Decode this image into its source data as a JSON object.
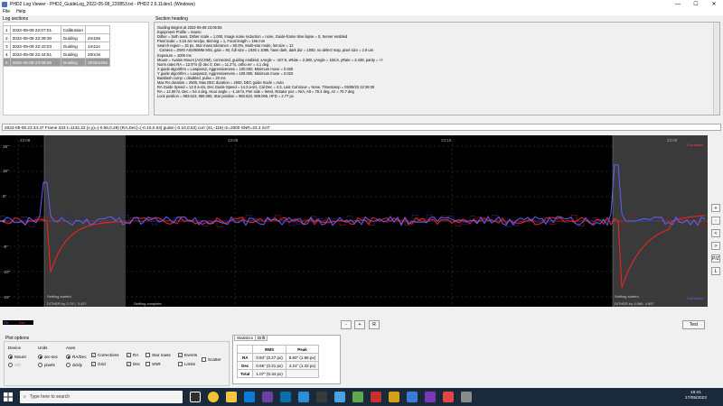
{
  "window": {
    "title": "PHD2 Log Viewer - PHD2_GuideLog_2022-05-08_220853.txt - PHD2 2.6.11dev1 (Windows)",
    "minimize": "—",
    "maximize": "☐",
    "close": "✕"
  },
  "menu": {
    "file": "File",
    "help": "Help"
  },
  "log_sections": {
    "label": "Log sections",
    "rows": [
      {
        "num": "1",
        "time": "2022-05-08 22:07:01",
        "type": "Calibration",
        "dur": ""
      },
      {
        "num": "2",
        "time": "2022-05-08 22:39:30",
        "type": "Guiding",
        "dur": "2m18s"
      },
      {
        "num": "3",
        "time": "2022-05-08 22:43:03",
        "type": "Guiding",
        "dur": "1m11s"
      },
      {
        "num": "4",
        "time": "2022-05-08 22:44:51",
        "type": "Guiding",
        "dur": "20m3s"
      },
      {
        "num": "5",
        "time": "2022-05-08 23:05:55",
        "type": "Guiding",
        "dur": "3h32m25s"
      }
    ]
  },
  "section_heading": {
    "label": "Section heading",
    "text": "Guiding Begins at 2022-05-08 23:05:55\nEquipment Profile = maero\nDither = both axes, Dither scale = 1.000, Image noise reduction = none, Guide-frame time lapse = 0, Server enabled\nPixel scale = 3.16 arc-sec/px, Binning = 1, Focal length = 166 mm\nSearch region = 15 px, Star mass tolerance = 50.0%, Multi-star mode, list size = 12\n  Camera = ZWO ASI290MM Mini, gain = 93, full size = 1936 x 1096, have dark, dark dur = 1000, no defect map, pixel size = 2.9 um\nExposure = 1000 ms\nMount = Avalon Mount (ASCOM), connected, guiding enabled, xAngle = -107.5, xRate = 2.380, yAngle = 160.8, yRate = 3.439, parity = +/-\nNorm rates RA = 12.9\"/s @ dec 0, Dec = 11.2\"/s, ortho err = 4.1 deg\nX guide algorithm = Lowpass2, Aggressiveness = 100.000, Minimum move = 0.020\nY guide algorithm = Lowpass2, Aggressiveness = 100.000, Minimum move = 0.020\nBacklash comp = disabled, pulse = 20 ms\nMax RA duration = 2500, Max DEC duration = 2500, DEC guide mode = Auto\nRA Guide Speed = 12.0 a-s/s, Dec Guide Speed = 14.3 a-s/s, Cal Dec = 4.3, Last Cal Issue = None, Timestamp = 05/08/22 22:39:30\nRA = 14.00 hr, Dec = 54.4 deg, Hour angle = -1.19 hr, Pier side = West, Rotator pos = N/A, Alt = 79.4 deg, Az = 70.7 deg\nLock position = 983.623, 869.060, Star position = 983.623, 869.066, HFD = 2.77 px"
  },
  "status_line": "2022-05-08 23:34:47 Frame 433 t=1132.22 (x,y)=(-0.56,0.28) (RA,Dec)=(-0.10,0.63) guide (-0.10,0.63) corr (41,-118) m=2000 SNR=23.4 SAT",
  "chart": {
    "time_labels": [
      "23:08",
      "23:09",
      "23:10",
      "23:09"
    ],
    "y_ticks": [
      "15\"",
      "10\"",
      "5\"",
      "0",
      "-5\"",
      "-10\"",
      "-15\""
    ],
    "corr_label_top": "Correction",
    "corr_label_bottom": "Correction",
    "settle_started_1": "Settling started",
    "dither_1": "DITHER by 2.79?, 3.43?",
    "settle_complete": "Settling complete",
    "settle_started_2": "Settling started",
    "dither_2": "DITHER by 4.066, 4.697",
    "colors": {
      "ra": "#6060ff",
      "dec": "#ff2020",
      "settle": "#3a3a3a",
      "grid": "#444444"
    }
  },
  "side_buttons": [
    "+",
    "-",
    "<",
    ">",
    "P/Z",
    "L"
  ],
  "legend": {
    "ra": "RA",
    "dec": "Dec"
  },
  "nav_buttons": {
    "minus": "-",
    "plus": "+",
    "reset": "R",
    "test": "Test"
  },
  "plot_options": {
    "label": "Plot options",
    "device": {
      "label": "Device",
      "mount": "Mount",
      "ao": "AO"
    },
    "units": {
      "label": "Units",
      "arcsec": "arc-sec",
      "pixels": "pixels"
    },
    "axes": {
      "label": "Axes",
      "radec": "RA/Dec",
      "dxdy": "dx/dy"
    },
    "checks": {
      "corrections": "Corrections",
      "grid": "Grid",
      "ra": "RA",
      "dec": "Dec",
      "star_mass": "Star mass",
      "snr": "SNR",
      "events": "Events",
      "limits": "Limits",
      "scatter": "Scatter"
    }
  },
  "statistics": {
    "tabs": [
      "Statistics",
      "Drift"
    ],
    "headers": [
      "",
      "RMS",
      "Peak"
    ],
    "rows": [
      {
        "label": "RA",
        "rms": "0.84\" (0.27 px)",
        "peak": "5.60\" (1.86 px)"
      },
      {
        "label": "Dec",
        "rms": "0.65\" (0.21 px)",
        "peak": "4.21\" (1.32 px)"
      },
      {
        "label": "Total",
        "rms": "1.07\" (0.34 px)",
        "peak": ""
      }
    ]
  },
  "taskbar": {
    "search_placeholder": "Type here to search",
    "time": "19:41",
    "date": "17/05/2022"
  }
}
